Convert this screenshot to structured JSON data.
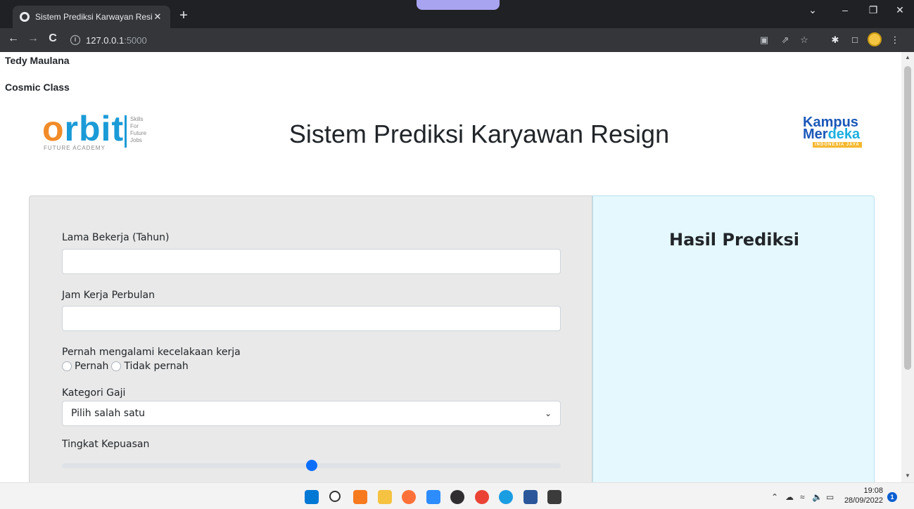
{
  "browser": {
    "tab_title": "Sistem Prediksi Karwayan Resign",
    "tab_close": "✕",
    "new_tab": "+",
    "url_host": "127.0.0.1",
    "url_port": ":5000",
    "window_controls": [
      "⌄",
      "–",
      "❐",
      "✕"
    ]
  },
  "page": {
    "author_name": "Tedy Maulana",
    "class_name": "Cosmic Class",
    "title": "Sistem Prediksi Karyawan Resign",
    "logo_left": {
      "word": "rbit",
      "o": "o",
      "tagline_lines": [
        "Skills",
        "For",
        "Future",
        "Jobs"
      ],
      "academy": "FUTURE ACADEMY"
    },
    "logo_right": {
      "line1": "Kampus",
      "line2_a": "Mer",
      "line2_b": "deka",
      "tag": "INDONESIA JAYA"
    }
  },
  "form": {
    "lama_bekerja_label": "Lama Bekerja (Tahun)",
    "lama_bekerja_value": "",
    "jam_kerja_label": "Jam Kerja Perbulan",
    "jam_kerja_value": "",
    "kecelakaan_label": "Pernah mengalami kecelakaan kerja",
    "kecelakaan_options": [
      "Pernah",
      "Tidak pernah"
    ],
    "gaji_label": "Kategori Gaji",
    "gaji_selected": "Pilih salah satu",
    "kepuasan_label": "Tingkat Kepuasan",
    "kepuasan_value_fraction": 0.5
  },
  "result": {
    "heading": "Hasil Prediksi"
  },
  "taskbar": {
    "time": "19:08",
    "date": "28/09/2022",
    "notifications": "1",
    "apps": [
      "windows-start",
      "search",
      "sublime-text",
      "file-explorer",
      "firefox",
      "zoom",
      "obs",
      "chrome",
      "edge",
      "word",
      "terminal"
    ],
    "app_colors": [
      "#0078d4",
      "#ffffff",
      "#f77a1e",
      "#f5c242",
      "#ff7139",
      "#2d8cff",
      "#302e31",
      "#ea4335",
      "#1b9de2",
      "#2b579a",
      "#3b3b3b"
    ]
  }
}
